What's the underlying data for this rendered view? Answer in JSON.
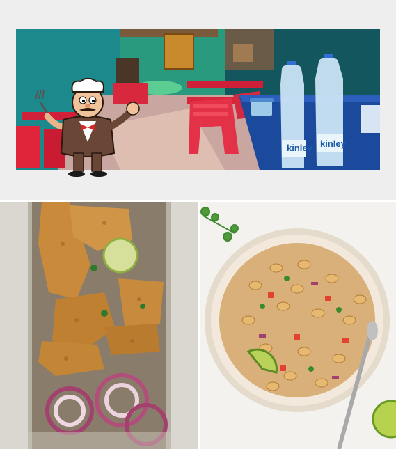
{
  "photos": [
    {
      "label": "restaurant-interior"
    },
    {
      "label": "fried-fish-with-onions"
    },
    {
      "label": "peanut-chaat-salad"
    }
  ],
  "bottle_brand": "kinley",
  "colors": {
    "wall_teal": "#1a6e73",
    "chair_red": "#e0243a",
    "table_blue": "#1b4a9c",
    "fried_fish": "#c98a3b",
    "onion_purple": "#a3416e",
    "bowl_cream": "#f2e9dc",
    "peanut": "#e7b970"
  },
  "icons": {
    "mascot": "chef-mascot-icon"
  }
}
